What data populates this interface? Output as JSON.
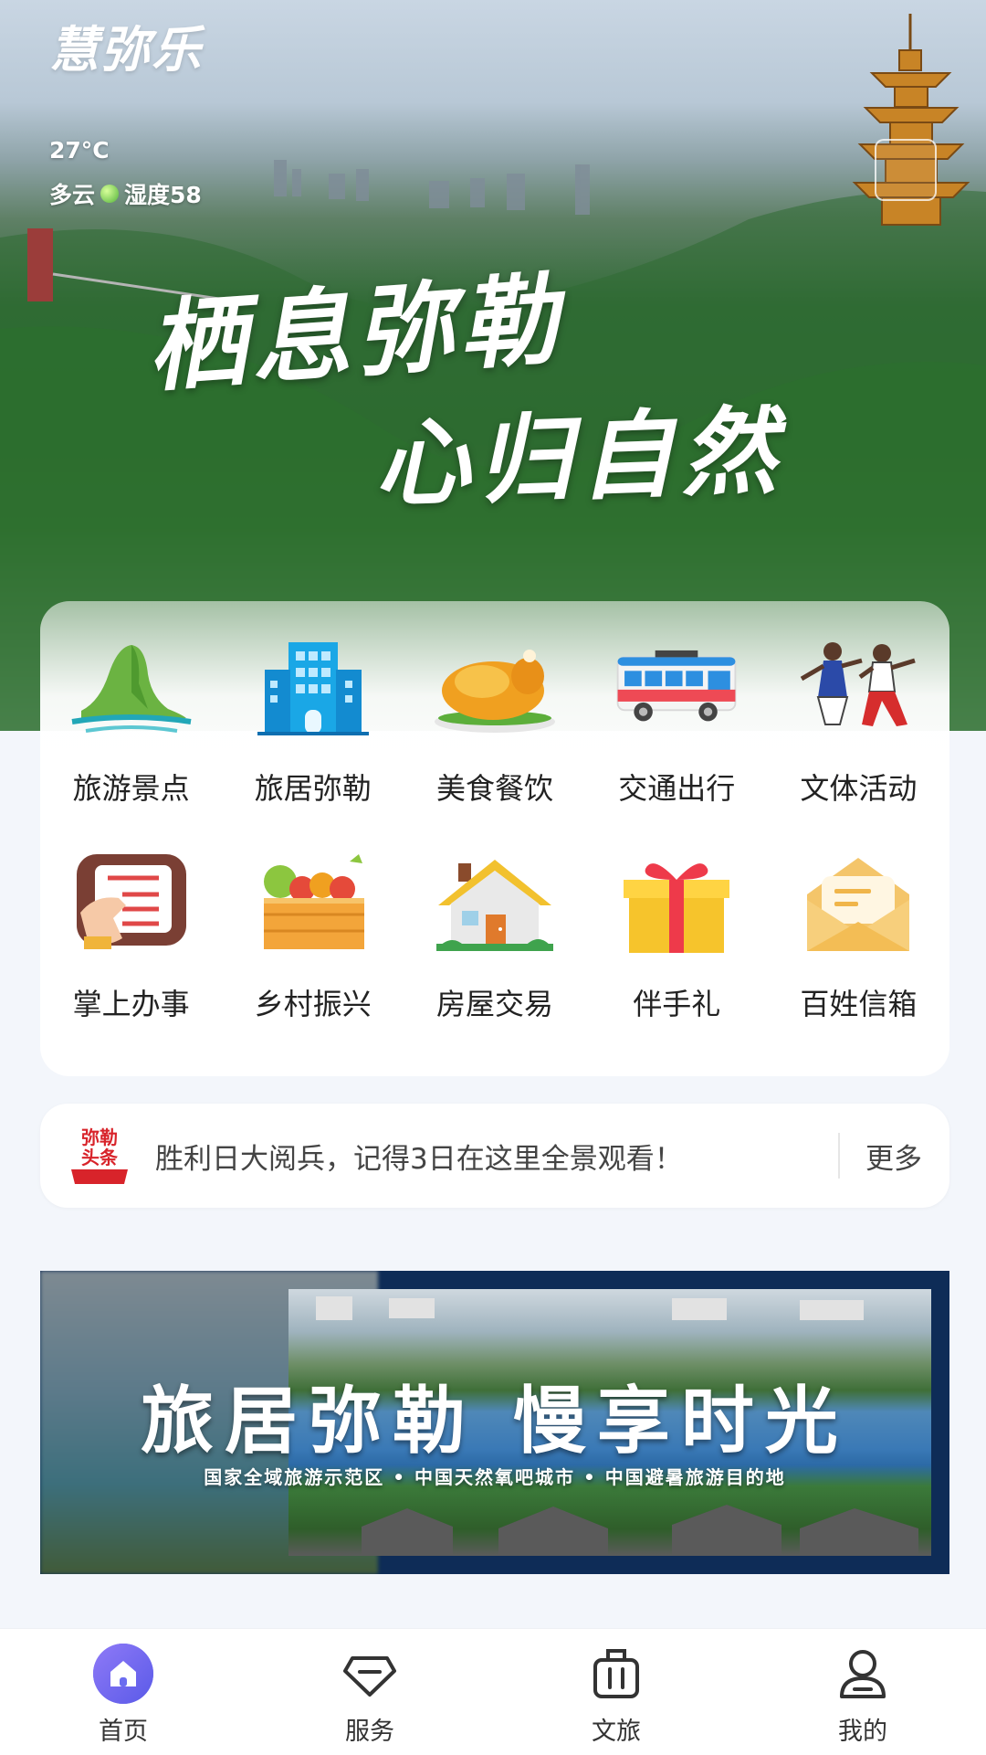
{
  "hero": {
    "brand": "慧弥乐",
    "temperature": "27°C",
    "weather": "多云",
    "humidity": "湿度58",
    "slogan_line1": "栖息弥勒",
    "slogan_line2": "心归自然"
  },
  "services": [
    {
      "label": "旅游景点",
      "icon": "mountain-icon"
    },
    {
      "label": "旅居弥勒",
      "icon": "building-icon"
    },
    {
      "label": "美食餐饮",
      "icon": "roast-chicken-icon"
    },
    {
      "label": "交通出行",
      "icon": "bus-icon"
    },
    {
      "label": "文体活动",
      "icon": "dancers-icon"
    },
    {
      "label": "掌上办事",
      "icon": "checklist-hand-icon"
    },
    {
      "label": "乡村振兴",
      "icon": "produce-crate-icon"
    },
    {
      "label": "房屋交易",
      "icon": "house-icon"
    },
    {
      "label": "伴手礼",
      "icon": "gift-icon"
    },
    {
      "label": "百姓信箱",
      "icon": "mail-icon"
    }
  ],
  "news": {
    "logo_line1": "弥勒",
    "logo_line2": "头条",
    "text": "胜利日大阅兵，记得3日在这里全景观看！",
    "more": "更多"
  },
  "banner": {
    "title": "旅居弥勒 慢享时光",
    "subtitle": "国家全域旅游示范区 • 中国天然氧吧城市 • 中国避暑旅游目的地"
  },
  "tabs": [
    {
      "label": "首页",
      "icon": "home-icon",
      "active": true
    },
    {
      "label": "服务",
      "icon": "diamond-icon",
      "active": false
    },
    {
      "label": "文旅",
      "icon": "luggage-icon",
      "active": false
    },
    {
      "label": "我的",
      "icon": "user-icon",
      "active": false
    }
  ],
  "colors": {
    "accent": "#6b6cf0",
    "card_bg": "#ffffff",
    "page_bg": "#f3f6fb"
  }
}
